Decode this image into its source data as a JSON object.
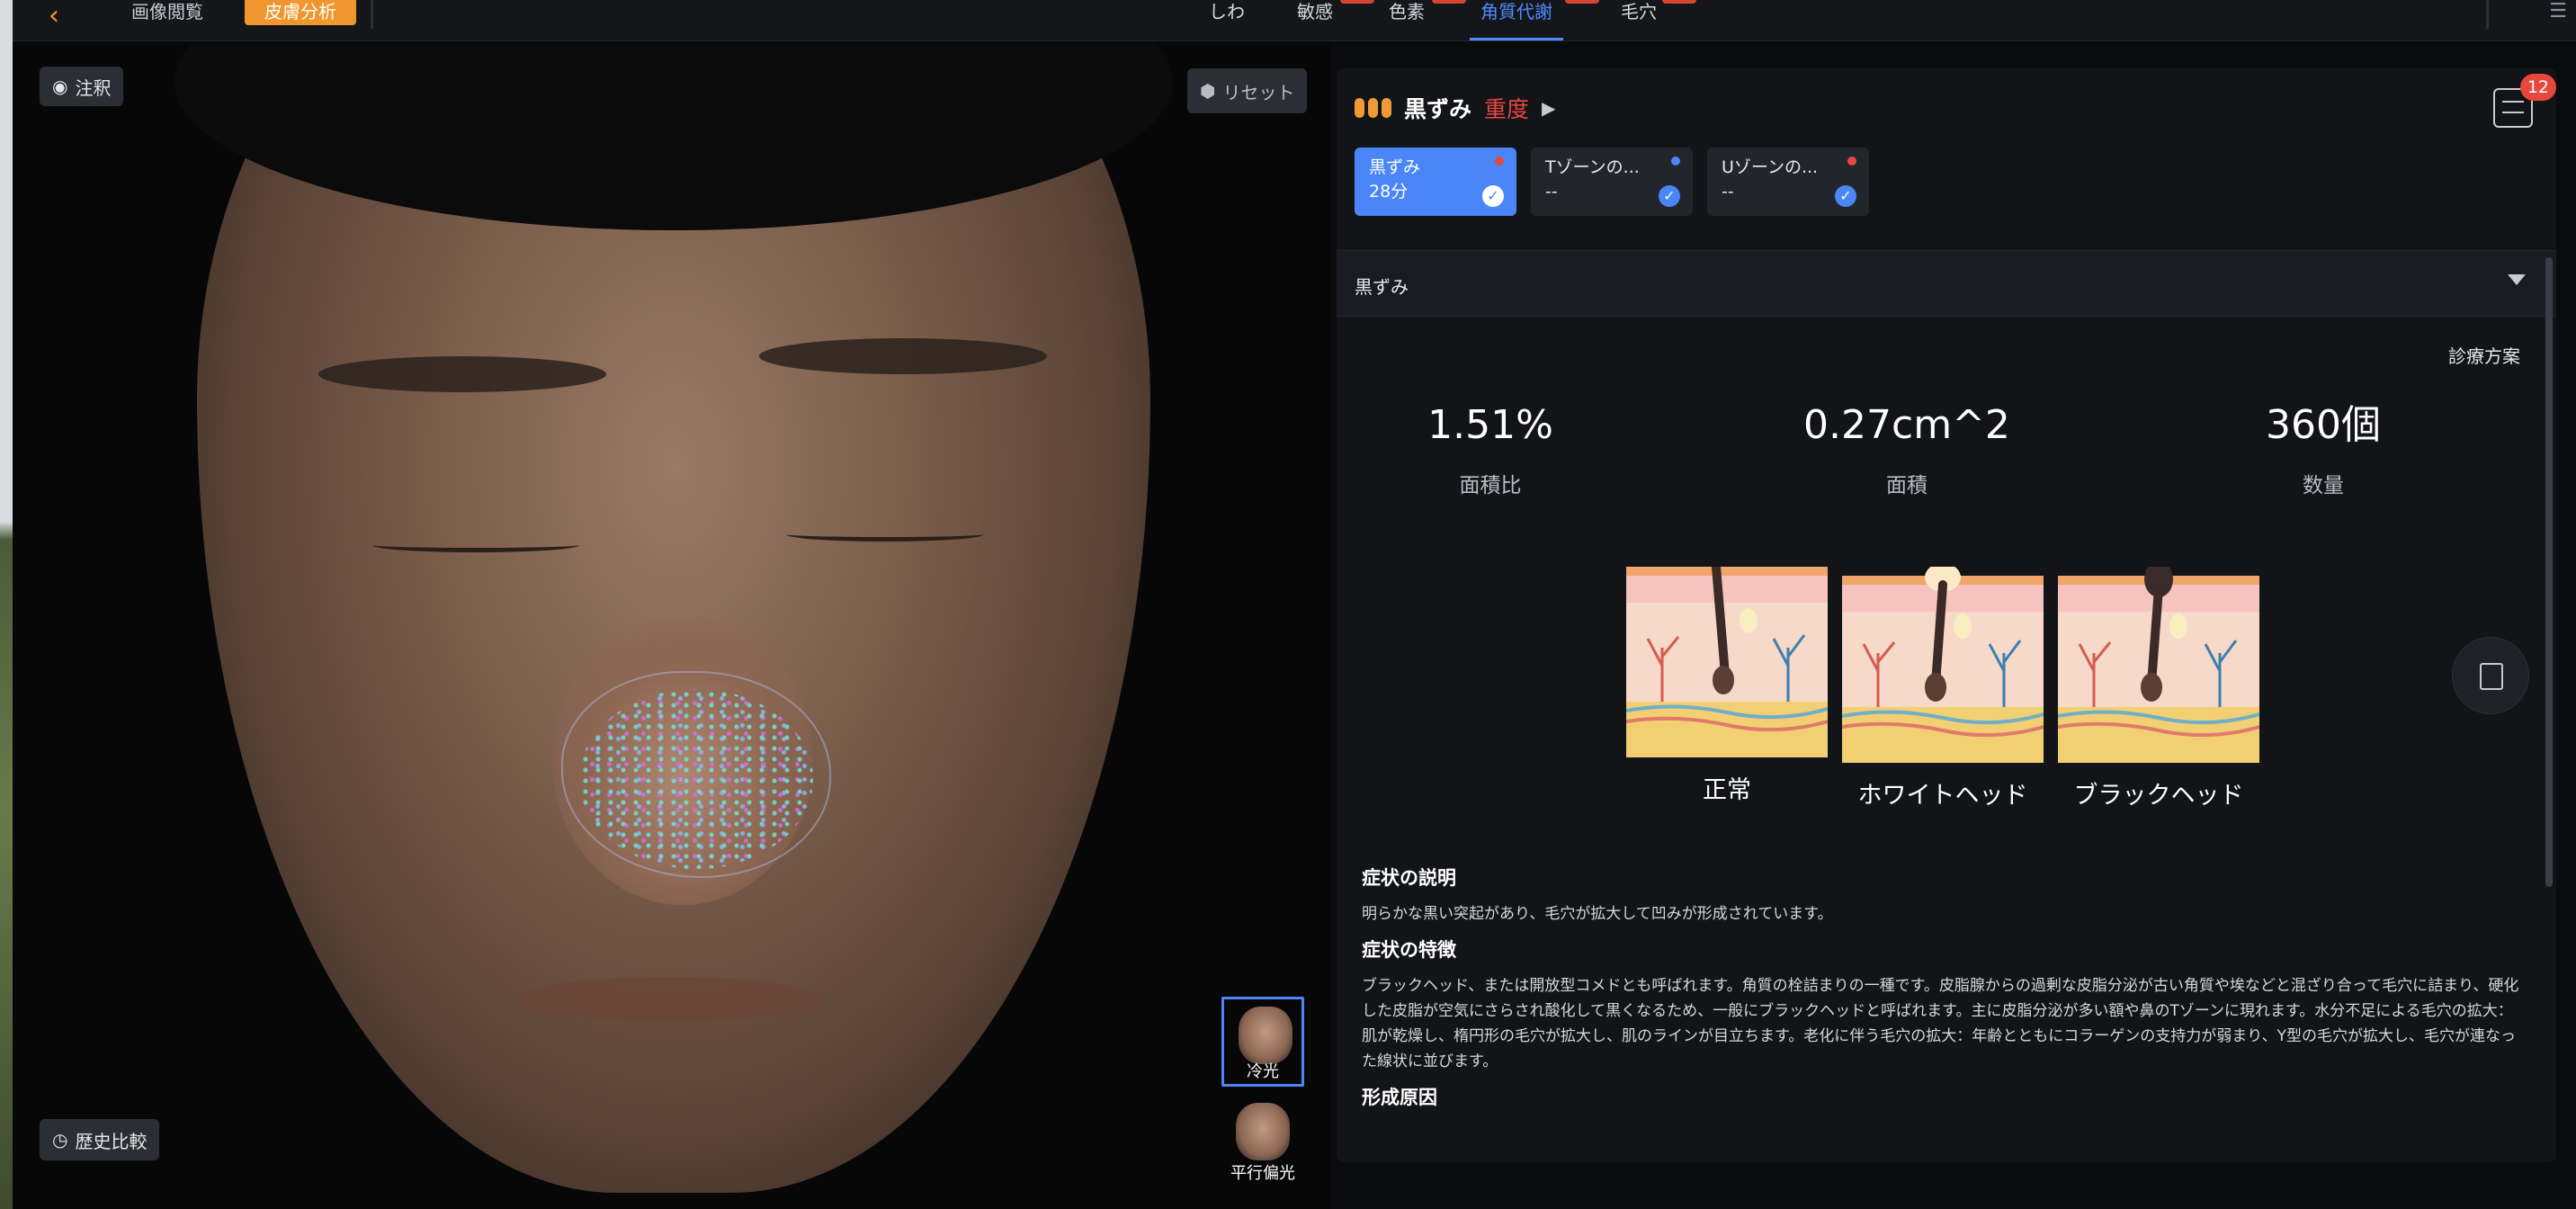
{
  "topbar": {
    "nav": [
      "画像閲覧",
      "皮膚分析"
    ],
    "tabs": [
      "しわ",
      "敏感",
      "色素",
      "角質代謝",
      "毛穴"
    ],
    "selected_tab": "角質代謝"
  },
  "viewer": {
    "annotation_label": "注釈",
    "reset_label": "リセット",
    "history_label": "歴史比較",
    "thumbnails": [
      "冷光",
      "平行偏光"
    ]
  },
  "panel": {
    "title": "黒ずみ",
    "severity": "重度",
    "badge_count": "12",
    "cards": [
      {
        "title": "黒ずみ",
        "score": "28分",
        "dot_color": "#e8473d"
      },
      {
        "title": "Tゾーンの...",
        "score": "--",
        "dot_color": "#4a86f7"
      },
      {
        "title": "Uゾーンの...",
        "score": "--",
        "dot_color": "#e8473d"
      }
    ],
    "section_title": "黒ずみ",
    "plan_label": "診療方案",
    "stats": [
      {
        "value": "1.51%",
        "label": "面積比"
      },
      {
        "value": "0.27cm^2",
        "label": "面積"
      },
      {
        "value": "360個",
        "label": "数量"
      }
    ],
    "illustrations": [
      "正常",
      "ホワイトヘッド",
      "ブラックヘッド"
    ],
    "desc_title": "症状の説明",
    "desc_text": "明らかな黒い突起があり、毛穴が拡大して凹みが形成されています。",
    "feature_title": "症状の特徴",
    "feature_text": "ブラックヘッド、または開放型コメドとも呼ばれます。角質の栓詰まりの一種です。皮脂腺からの過剰な皮脂分泌が古い角質や埃などと混ざり合って毛穴に詰まり、硬化した皮脂が空気にさらされ酸化して黒くなるため、一般にブラックヘッドと呼ばれます。主に皮脂分泌が多い額や鼻のTゾーンに現れます。水分不足による毛穴の拡大：肌が乾燥し、楕円形の毛穴が拡大し、肌のラインが目立ちます。老化に伴う毛穴の拡大：年齢とともにコラーゲンの支持力が弱まり、Y型の毛穴が拡大し、毛穴が連なった線状に並びます。",
    "cause_title": "形成原因"
  },
  "colors": {
    "accent_orange": "#f09a36",
    "accent_blue": "#4d8cff",
    "severity_red": "#e8473d"
  }
}
